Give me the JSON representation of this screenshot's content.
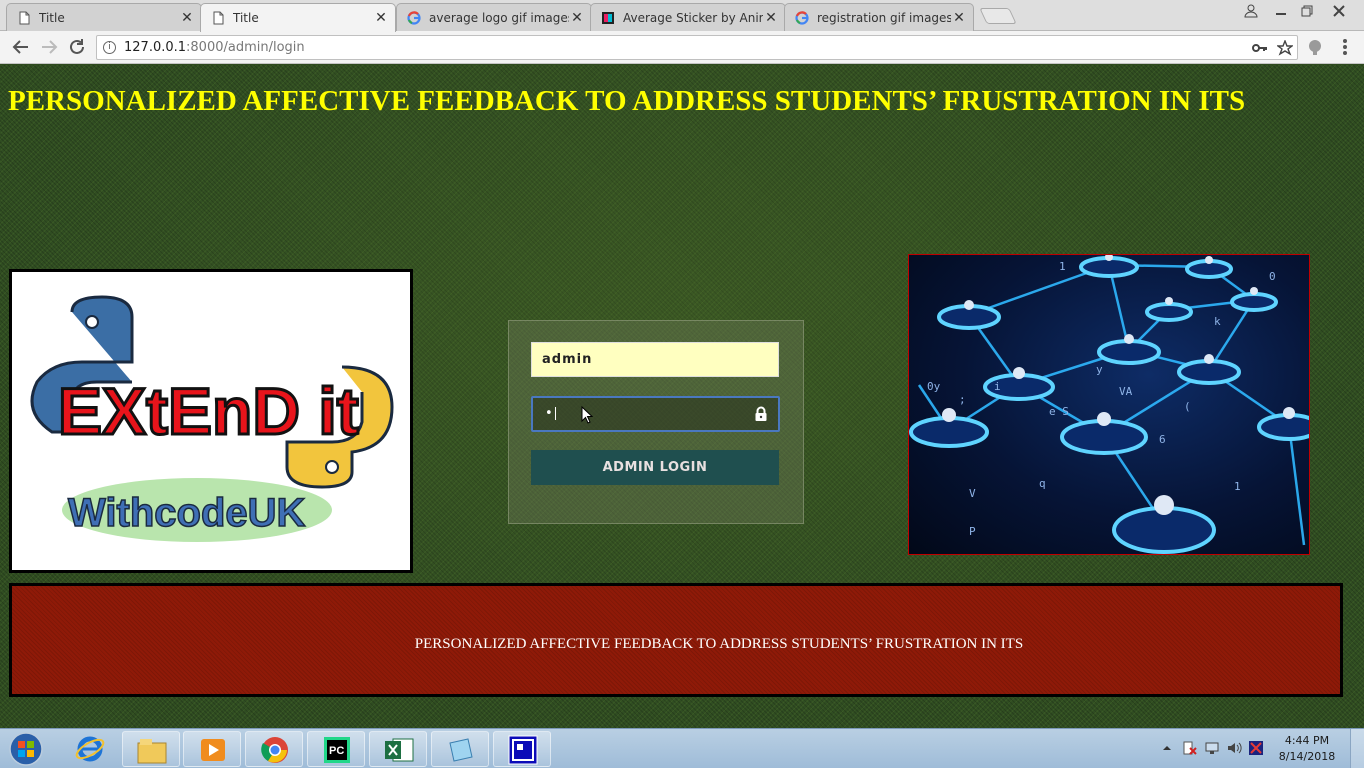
{
  "browser": {
    "tabs": [
      {
        "title": "Title",
        "icon": "page-icon",
        "active": false
      },
      {
        "title": "Title",
        "icon": "page-icon",
        "active": true
      },
      {
        "title": "average logo gif images",
        "icon": "google-icon",
        "active": false
      },
      {
        "title": "Average Sticker by Anima",
        "icon": "sticker-icon",
        "active": false
      },
      {
        "title": "registration gif images - G",
        "icon": "google-icon",
        "active": false
      }
    ],
    "close_glyph": "✕",
    "url_host": "127.0.0.1",
    "url_path": ":8000/admin/login"
  },
  "page": {
    "headline": "PERSONALIZED AFFECTIVE FEEDBACK TO ADDRESS STUDENTS’ FRUSTRATION IN ITS",
    "logo": {
      "line1": "EXtEnD it",
      "line2": "WithcodeUK"
    },
    "network_chars": [
      "1",
      "0",
      "k",
      "y",
      "VA",
      "e S",
      "6",
      "q",
      "V",
      "P",
      "0y",
      "i",
      ";",
      "(",
      "1"
    ],
    "login": {
      "username_value": "admin",
      "password_mask": "•",
      "button_label": "ADMIN LOGIN"
    },
    "footer_text": "PERSONALIZED AFFECTIVE FEEDBACK TO ADDRESS STUDENTS’ FRUSTRATION IN ITS"
  },
  "taskbar": {
    "time": "4:44 PM",
    "date": "8/14/2018",
    "pinned": [
      "file-explorer-icon",
      "internet-explorer-icon",
      "media-player-icon",
      "chrome-icon",
      "pycharm-icon",
      "excel-icon",
      "notepad-icon",
      "app-window-icon"
    ]
  },
  "colors": {
    "headline": "#ffff00",
    "footer_bg": "#8f1a08",
    "login_button_bg": "#1f4f4f",
    "username_bg": "#ffffc0",
    "page_bg": "#304d22"
  }
}
